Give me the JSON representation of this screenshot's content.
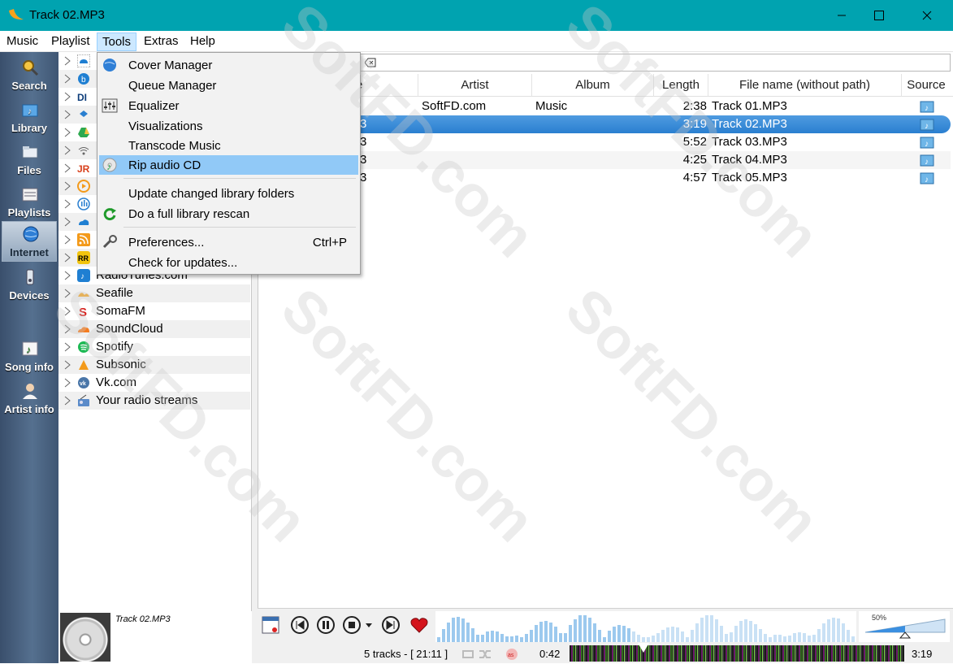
{
  "window": {
    "title": "Track 02.MP3"
  },
  "menubar": {
    "items": [
      "Music",
      "Playlist",
      "Tools",
      "Extras",
      "Help"
    ]
  },
  "sidebar": {
    "items": [
      "Search",
      "Library",
      "Files",
      "Playlists",
      "Internet",
      "Devices",
      "Song info",
      "Artist info"
    ]
  },
  "tree": {
    "items": [
      "",
      "",
      "",
      "",
      "",
      "",
      "",
      "",
      "",
      "",
      "",
      "",
      "RadioTunes.com",
      "Seafile",
      "SomaFM",
      "SoundCloud",
      "Spotify",
      "Subsonic",
      "Vk.com",
      "Your radio streams"
    ]
  },
  "playlist": {
    "columns": [
      "e",
      "Artist",
      "Album",
      "Length",
      "File name (without path)",
      "Source"
    ],
    "rows": [
      {
        "title": "",
        "artist": "SoftFD.com",
        "album": "Music",
        "length": "2:38",
        "file": "Track 01.MP3"
      },
      {
        "title": "3",
        "artist": "",
        "album": "",
        "length": "3:19",
        "file": "Track 02.MP3"
      },
      {
        "title": "3",
        "artist": "",
        "album": "",
        "length": "5:52",
        "file": "Track 03.MP3"
      },
      {
        "title": "3",
        "artist": "",
        "album": "",
        "length": "4:25",
        "file": "Track 04.MP3"
      },
      {
        "title": "3",
        "artist": "",
        "album": "",
        "length": "4:57",
        "file": "Track 05.MP3"
      }
    ]
  },
  "tools_menu": {
    "items": [
      {
        "label": "Cover Manager",
        "shortcut": ""
      },
      {
        "label": "Queue Manager",
        "shortcut": ""
      },
      {
        "label": "Equalizer",
        "shortcut": ""
      },
      {
        "label": "Visualizations",
        "shortcut": ""
      },
      {
        "label": "Transcode Music",
        "shortcut": ""
      },
      {
        "label": "Rip audio CD",
        "shortcut": ""
      },
      {
        "label": "Update changed library folders",
        "shortcut": ""
      },
      {
        "label": "Do a full library rescan",
        "shortcut": ""
      },
      {
        "label": "Preferences...",
        "shortcut": "Ctrl+P"
      },
      {
        "label": "Check for updates...",
        "shortcut": ""
      }
    ]
  },
  "now_playing": {
    "title": "Track 02.MP3"
  },
  "status": {
    "tracks": "5 tracks - [ 21:11 ]",
    "elapsed": "0:42",
    "total": "3:19",
    "volume_pct": "50%"
  },
  "watermark": "SoftFD.com",
  "colors": {
    "titlebar": "#00a3b0",
    "selection": "#2a7fd0",
    "menu_highlight": "#91c9f7"
  }
}
